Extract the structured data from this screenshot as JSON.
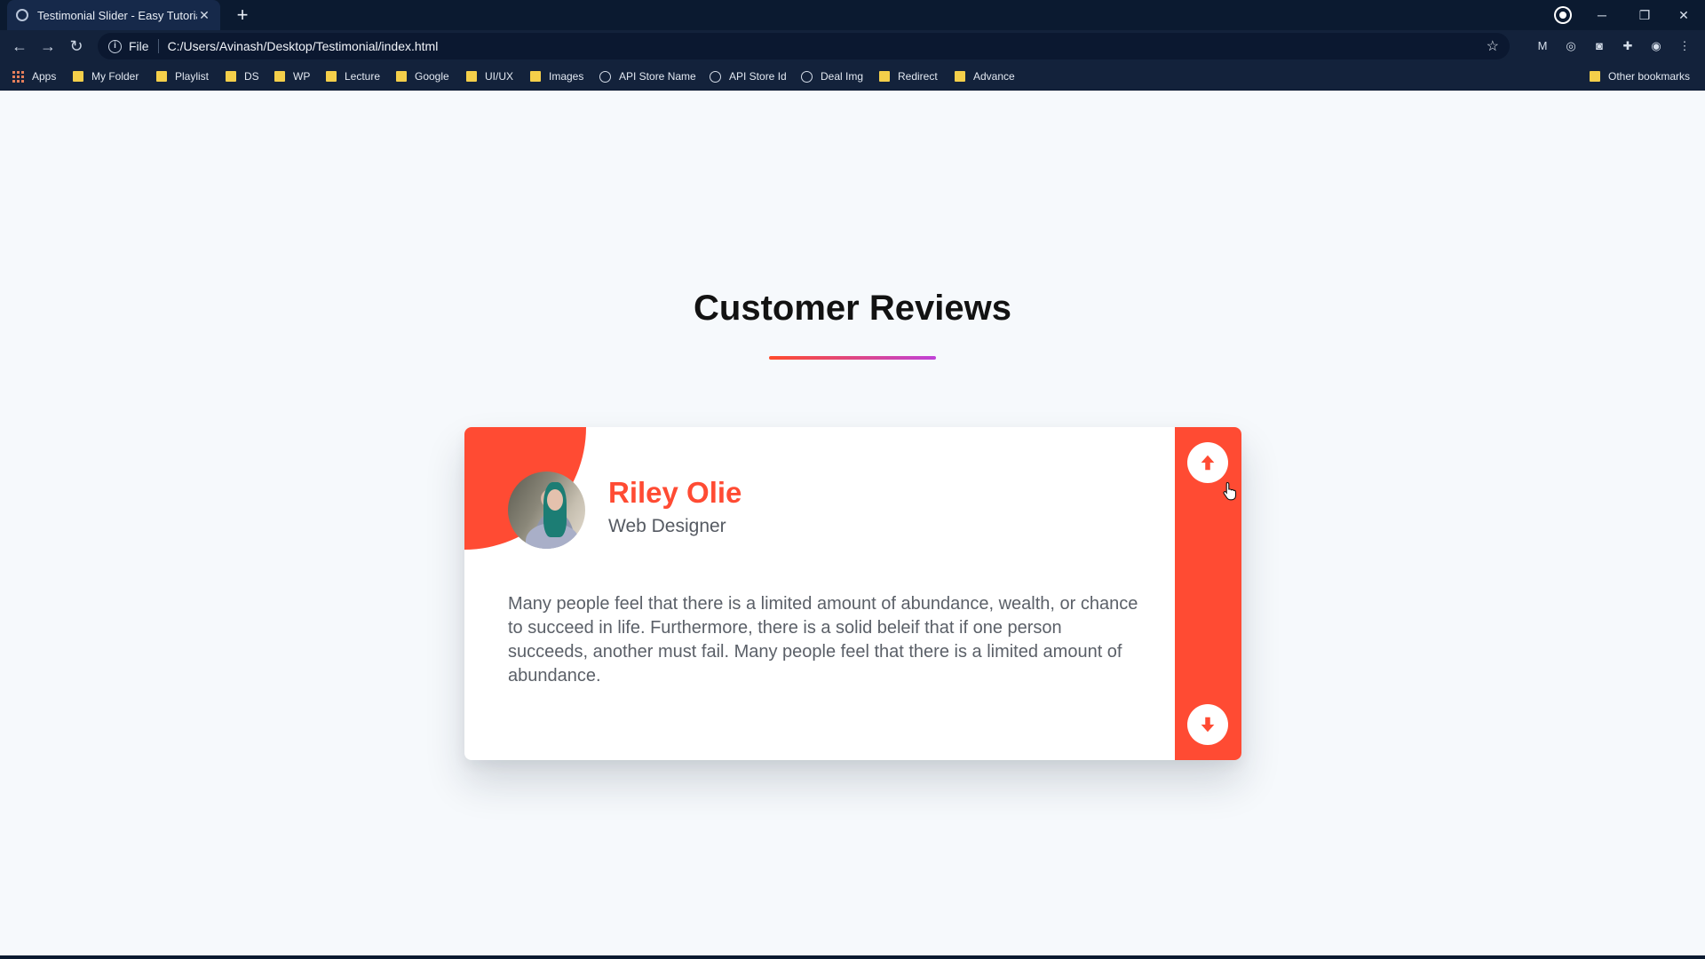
{
  "browser": {
    "tab_title": "Testimonial Slider - Easy Tutorials",
    "scheme_label": "File",
    "url": "C:/Users/Avinash/Desktop/Testimonial/index.html"
  },
  "bookmarks": {
    "items": [
      {
        "label": "Apps",
        "icon": "apps-grid-icon"
      },
      {
        "label": "My Folder",
        "icon": "folder-icon"
      },
      {
        "label": "Playlist",
        "icon": "folder-icon"
      },
      {
        "label": "DS",
        "icon": "folder-icon"
      },
      {
        "label": "WP",
        "icon": "folder-icon"
      },
      {
        "label": "Lecture",
        "icon": "folder-icon"
      },
      {
        "label": "Google",
        "icon": "folder-icon"
      },
      {
        "label": "UI/UX",
        "icon": "folder-icon"
      },
      {
        "label": "Images",
        "icon": "folder-icon"
      },
      {
        "label": "API Store Name",
        "icon": "globe-icon"
      },
      {
        "label": "API Store Id",
        "icon": "globe-icon"
      },
      {
        "label": "Deal Img",
        "icon": "globe-icon"
      },
      {
        "label": "Redirect",
        "icon": "folder-icon"
      },
      {
        "label": "Advance",
        "icon": "folder-icon"
      }
    ],
    "other": "Other bookmarks"
  },
  "page": {
    "heading": "Customer Reviews",
    "testimonial": {
      "name": "Riley Olie",
      "role": "Web Designer",
      "quote": "Many people feel that there is a limited amount of abundance, wealth, or chance to succeed in life. Furthermore, there is a solid beleif that if one person succeeds, another must fail. Many people feel that there is a limited amount of abundance."
    }
  },
  "colors": {
    "accent": "#ff4b33",
    "heading": "#121212",
    "page_bg": "#f6f9fc",
    "chrome_bg": "#13223b"
  }
}
